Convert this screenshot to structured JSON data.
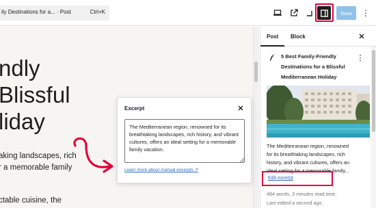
{
  "topbar": {
    "document_title": "ily Destinations for a... · Post",
    "shortcut": "Ctrl+K",
    "save_label": "Save",
    "icons": [
      "desktop-preview-icon",
      "external-link-icon",
      "fullscreen-icon",
      "settings-sidebar-icon",
      "more-vertical-icon"
    ],
    "accent_color": "#8fc1ea",
    "highlight_color": "#e2003c"
  },
  "canvas": {
    "heading_lines": [
      "ndly",
      "Blissful",
      "liday"
    ],
    "body_lines": [
      "aking landscapes, rich",
      "r a memorable family",
      "ctable cuisine, the"
    ]
  },
  "excerpt_popover": {
    "title": "Excerpt",
    "text": "The Mediterranean region, renowned for its breathtaking landscapes, rich history, and vibrant cultures, offers an ideal setting for a memorable family vacation.",
    "learn_more": "Learn more about manual excerpts ↗"
  },
  "sidebar": {
    "tabs": [
      "Post",
      "Block"
    ],
    "post_title_lines": [
      "5 Best Family-Friendly",
      "Destinations for a Blissful",
      "Mediterranean Holiday"
    ],
    "excerpt_lines": [
      "The Mediterranean region, renowned",
      "for its breathtaking landscapes, rich",
      "history, and vibrant cultures, offers an",
      "ideal setting for a memorable family..."
    ],
    "edit_excerpt": "Edit excerpt",
    "word_count": "484 words, 3 minutes read time.",
    "last_edited": "Last edited a second ago."
  }
}
